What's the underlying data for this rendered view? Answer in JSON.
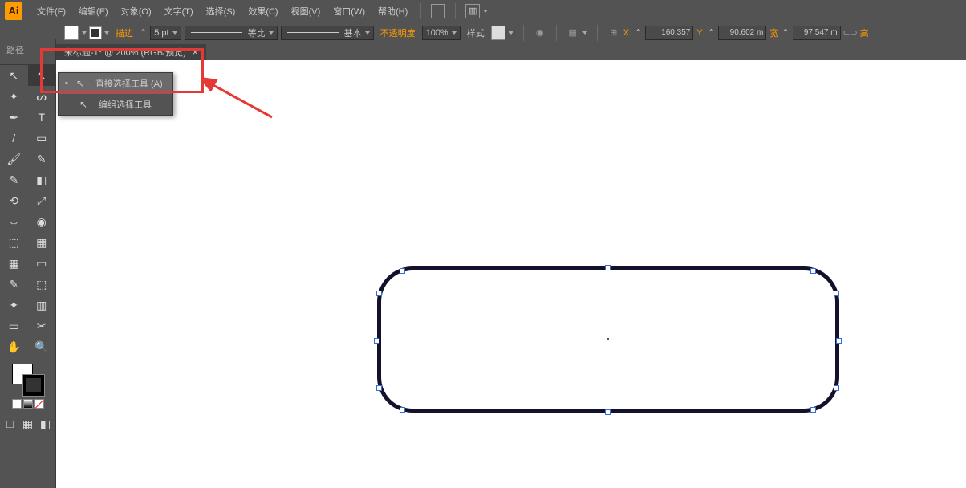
{
  "app": {
    "logo": "Ai"
  },
  "menu": [
    "文件(F)",
    "编辑(E)",
    "对象(O)",
    "文字(T)",
    "选择(S)",
    "效果(C)",
    "视图(V)",
    "窗口(W)",
    "帮助(H)"
  ],
  "control": {
    "path_label": "路径",
    "stroke_label": "描边",
    "stroke_weight": "5 pt",
    "var_width_label": "等比",
    "brush_label": "基本",
    "opacity_label": "不透明度",
    "opacity_value": "100%",
    "style_label": "样式",
    "x_label": "X:",
    "x_value": "160.357",
    "y_label": "Y:",
    "y_value": "90.602 m",
    "w_label": "宽",
    "w_value": "97.547 m",
    "h_label": "高"
  },
  "tab": {
    "title": "未标题-1* @ 200% (RGB/预览)"
  },
  "flyout": {
    "item1": "直接选择工具  (A)",
    "item2": "编组选择工具"
  },
  "tooltip": {
    "direct_select": "直接选择工具"
  },
  "tools": {
    "selection": "↖",
    "direct": "↖",
    "wand": "✦",
    "lasso": "ᔕ",
    "pen": "✒",
    "type": "T",
    "line": "/",
    "rect": "▭",
    "brush": "🖌",
    "pencil": "✎",
    "blob": "✎",
    "eraser": "◧",
    "rotate": "⟲",
    "scale": "⤢",
    "width": "⇔",
    "warp": "◉",
    "shapebuilder": "⬚",
    "perspective": "▦",
    "mesh": "▦",
    "gradient": "▭",
    "eyedrop": "✎",
    "blend": "⬚",
    "symbol": "✦",
    "graph": "▥",
    "artboard": "▭",
    "slice": "✂",
    "hand": "✋",
    "zoom": "🔍"
  },
  "mini_btm": [
    "□",
    "▦",
    "◧"
  ]
}
